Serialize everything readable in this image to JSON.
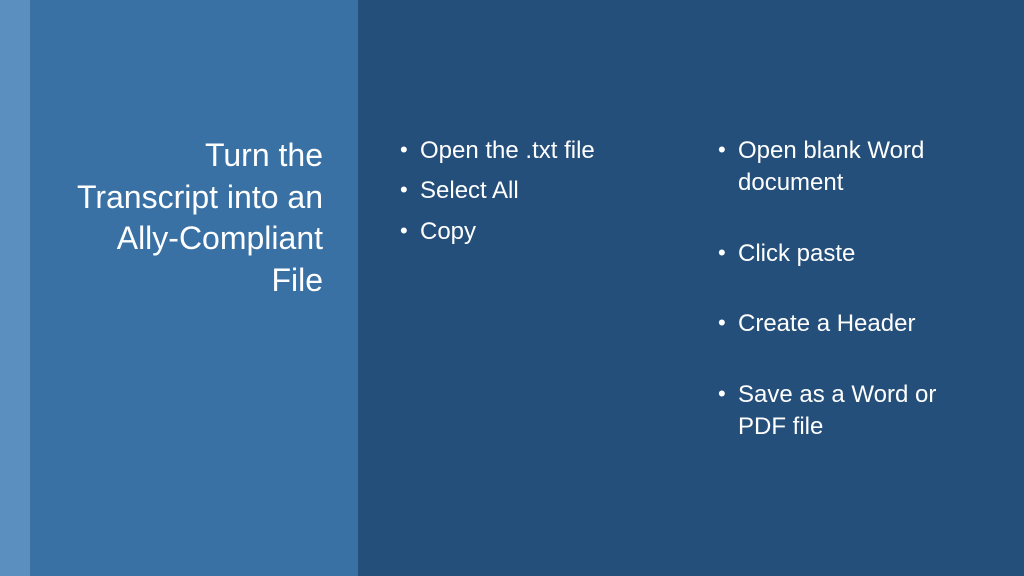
{
  "title": "Turn the Transcript into an Ally-Compliant File",
  "columns": {
    "left": {
      "items": [
        {
          "text": "Open the .txt file",
          "spaced": false
        },
        {
          "text": "Select All",
          "spaced": false
        },
        {
          "text": "Copy",
          "spaced": false
        }
      ]
    },
    "right": {
      "items": [
        {
          "text": "Open blank Word document",
          "spaced": true
        },
        {
          "text": "Click paste",
          "spaced": true
        },
        {
          "text": "Create a Header",
          "spaced": true
        },
        {
          "text": "Save as a Word or PDF file",
          "spaced": false
        }
      ]
    }
  }
}
